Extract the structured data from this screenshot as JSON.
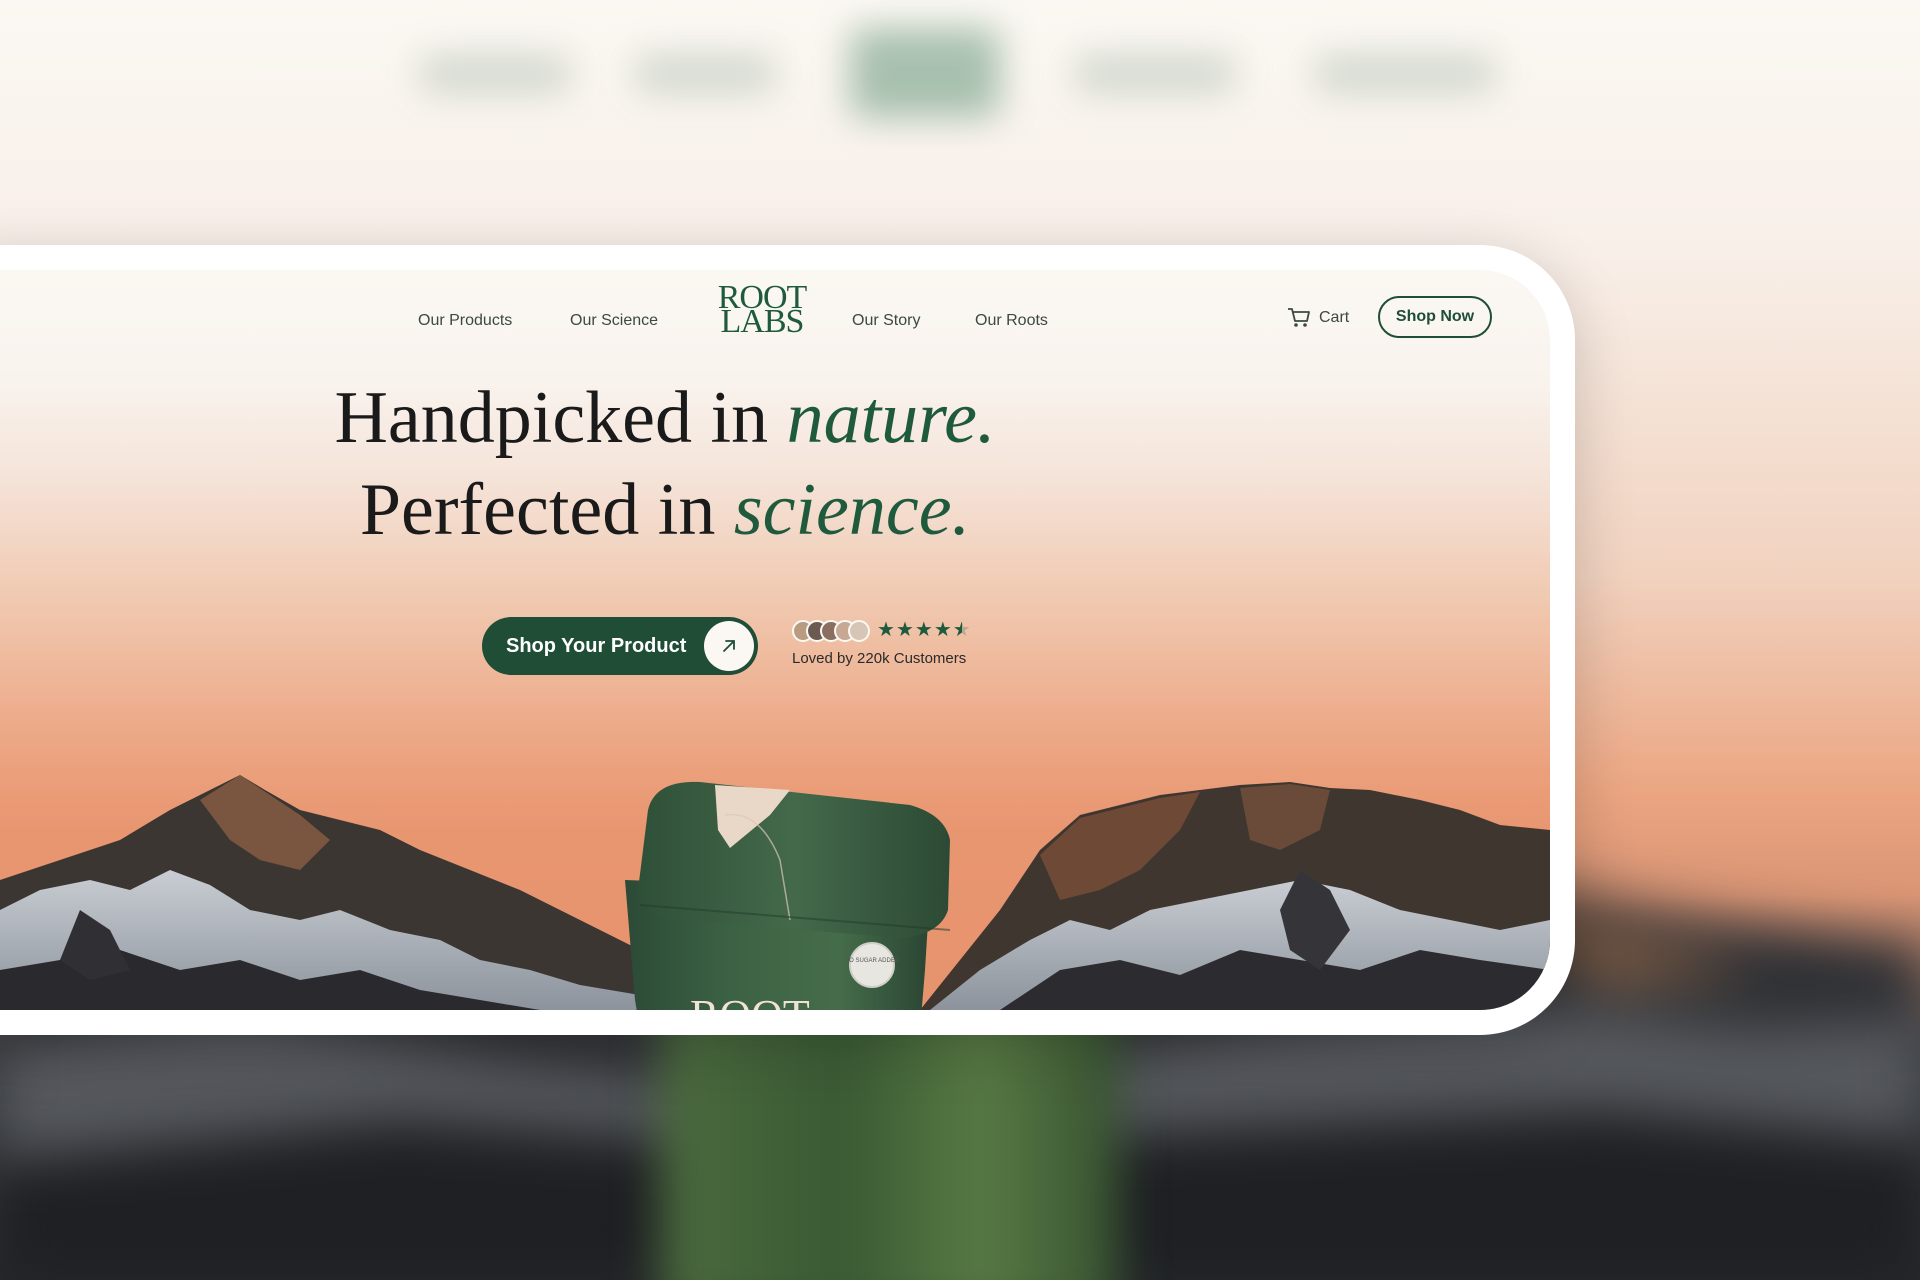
{
  "nav": {
    "links": [
      "Our Products",
      "Our Science",
      "Our Story",
      "Our Roots"
    ],
    "logo_line1": "ROOT",
    "logo_line2": "LABS",
    "cart_label": "Cart",
    "shop_now_label": "Shop Now"
  },
  "hero": {
    "line1_prefix": "Handpicked in ",
    "line1_emphasis": "nature.",
    "line2_prefix": "Perfected in ",
    "line2_emphasis": "science.",
    "cta_label": "Shop Your Product",
    "rating_stars": 4.5,
    "loved_text": "Loved by 220k Customers"
  },
  "product": {
    "brand_text": "ROOT",
    "badge_text": "NO SUGAR ADDED"
  },
  "colors": {
    "brand_green": "#1f4d36",
    "accent_green": "#1f5a3d",
    "sky_peach": "#e8966f"
  },
  "icons": {
    "cart": "cart-icon",
    "cta_arrow": "arrow-up-right-icon",
    "star": "star-icon"
  }
}
